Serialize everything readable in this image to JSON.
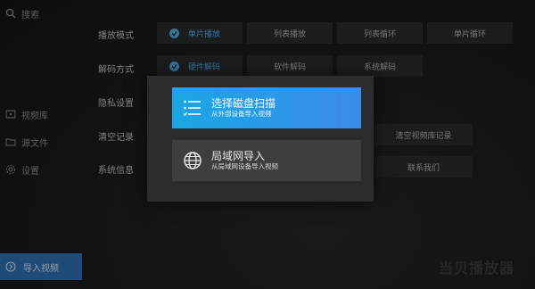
{
  "sidebar": {
    "search_label": "搜索",
    "items": [
      {
        "label": "视频库",
        "icon": "video-library-icon"
      },
      {
        "label": "源文件",
        "icon": "folder-icon"
      },
      {
        "label": "设置",
        "icon": "gear-icon"
      }
    ],
    "import_label": "导入视频",
    "import_icon": "import-arrow-icon"
  },
  "settings": {
    "rows": [
      {
        "label": "播放模式",
        "options": [
          "单片播放",
          "列表播放",
          "列表循环",
          "单片循环"
        ],
        "selected": 0
      },
      {
        "label": "解码方式",
        "options": [
          "硬件解码",
          "软件解码",
          "系统解码"
        ],
        "selected": 0
      },
      {
        "label": "隐私设置",
        "options": []
      },
      {
        "label": "清空记录",
        "options": [
          "清空视频库记录"
        ]
      },
      {
        "label": "系统信息",
        "options": [
          "联系我们"
        ]
      }
    ]
  },
  "dialog": {
    "scan": {
      "title": "选择磁盘扫描",
      "subtitle": "从外部设备导入视频",
      "icon": "list-scan-icon"
    },
    "lan": {
      "title": "局域网导入",
      "subtitle": "从局域网设备导入视频",
      "icon": "globe-icon"
    }
  },
  "watermark": "当贝播放器",
  "colors": {
    "accent": "#4fb3e8",
    "import_bg": "#2f73b8",
    "scan_gradient_start": "#1aa7e6",
    "scan_gradient_end": "#3b8bea"
  }
}
